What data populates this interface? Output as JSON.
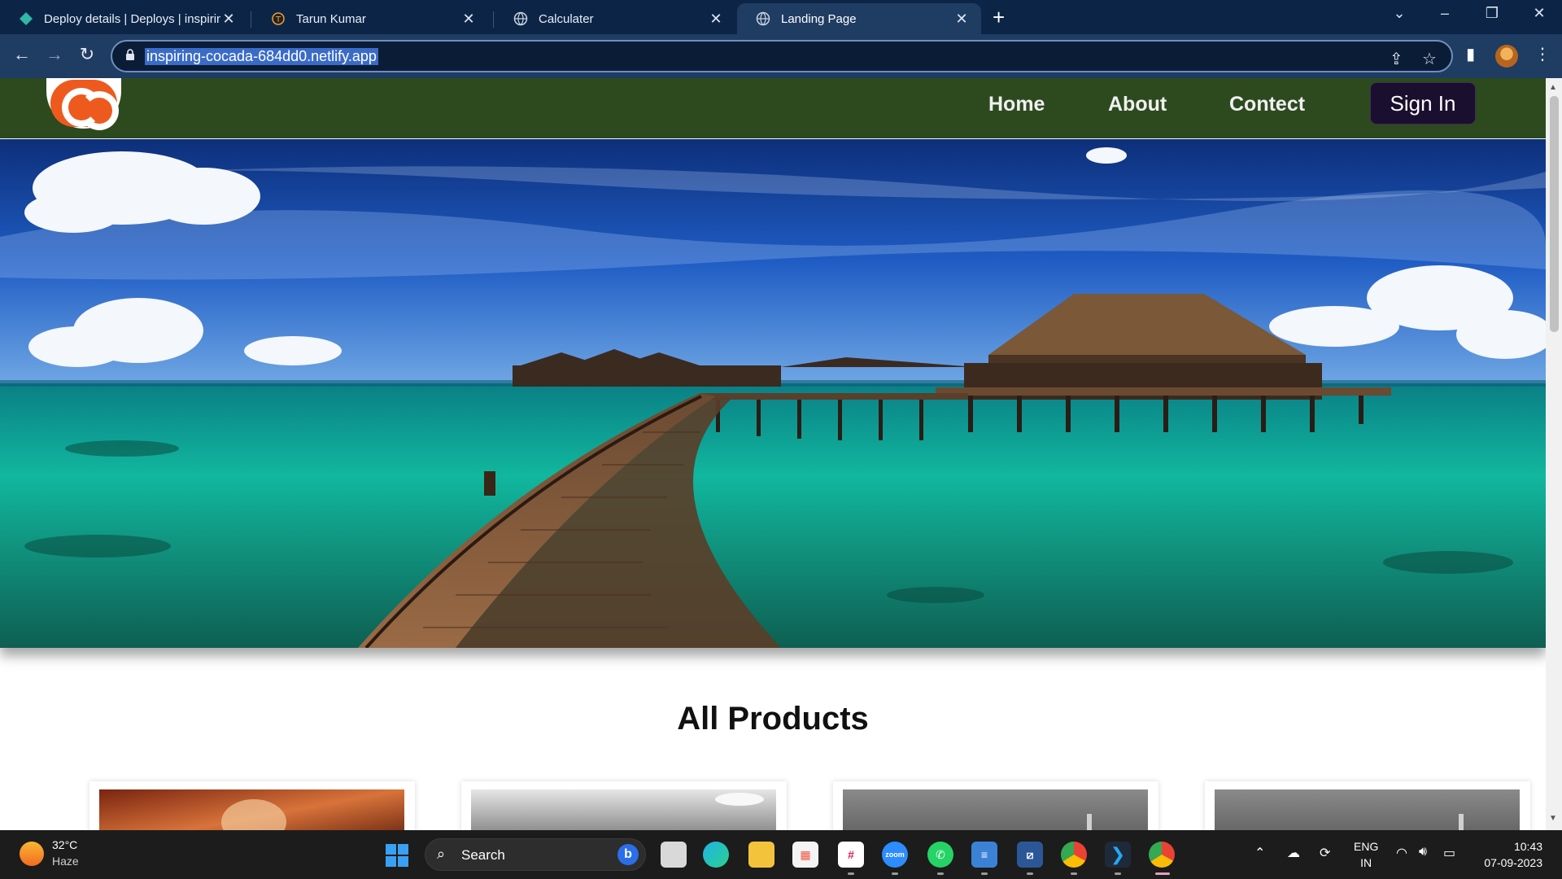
{
  "browser": {
    "tabs": [
      {
        "title": "Deploy details | Deploys | inspirin",
        "icon": "netlify-icon",
        "active": false
      },
      {
        "title": "Tarun Kumar",
        "icon": "t-icon",
        "active": false
      },
      {
        "title": "Calculater",
        "icon": "globe-icon",
        "active": false
      },
      {
        "title": "Landing Page",
        "icon": "globe-icon",
        "active": true
      }
    ],
    "new_tab": "+",
    "url": "inspiring-cocada-684dd0.netlify.app"
  },
  "site": {
    "nav": {
      "home": "Home",
      "about": "About",
      "contact": "Contect",
      "sign_in": "Sign In"
    },
    "hero_alt": "Overwater bungalows with wooden pier over turquoise sea",
    "section_title": "All Products",
    "product_cards": 4
  },
  "taskbar": {
    "temperature": "32°C",
    "weather": "Haze",
    "search_label": "Search",
    "lang_top": "ENG",
    "lang_bottom": "IN",
    "time": "10:43",
    "date": "07-09-2023"
  },
  "colors": {
    "navbar": "#2d4a1f",
    "signin_bg": "#1a0f2e",
    "tabbar": "#0c2547",
    "toolbar": "#1f3c63",
    "logo_orange": "#ee5a1e"
  }
}
